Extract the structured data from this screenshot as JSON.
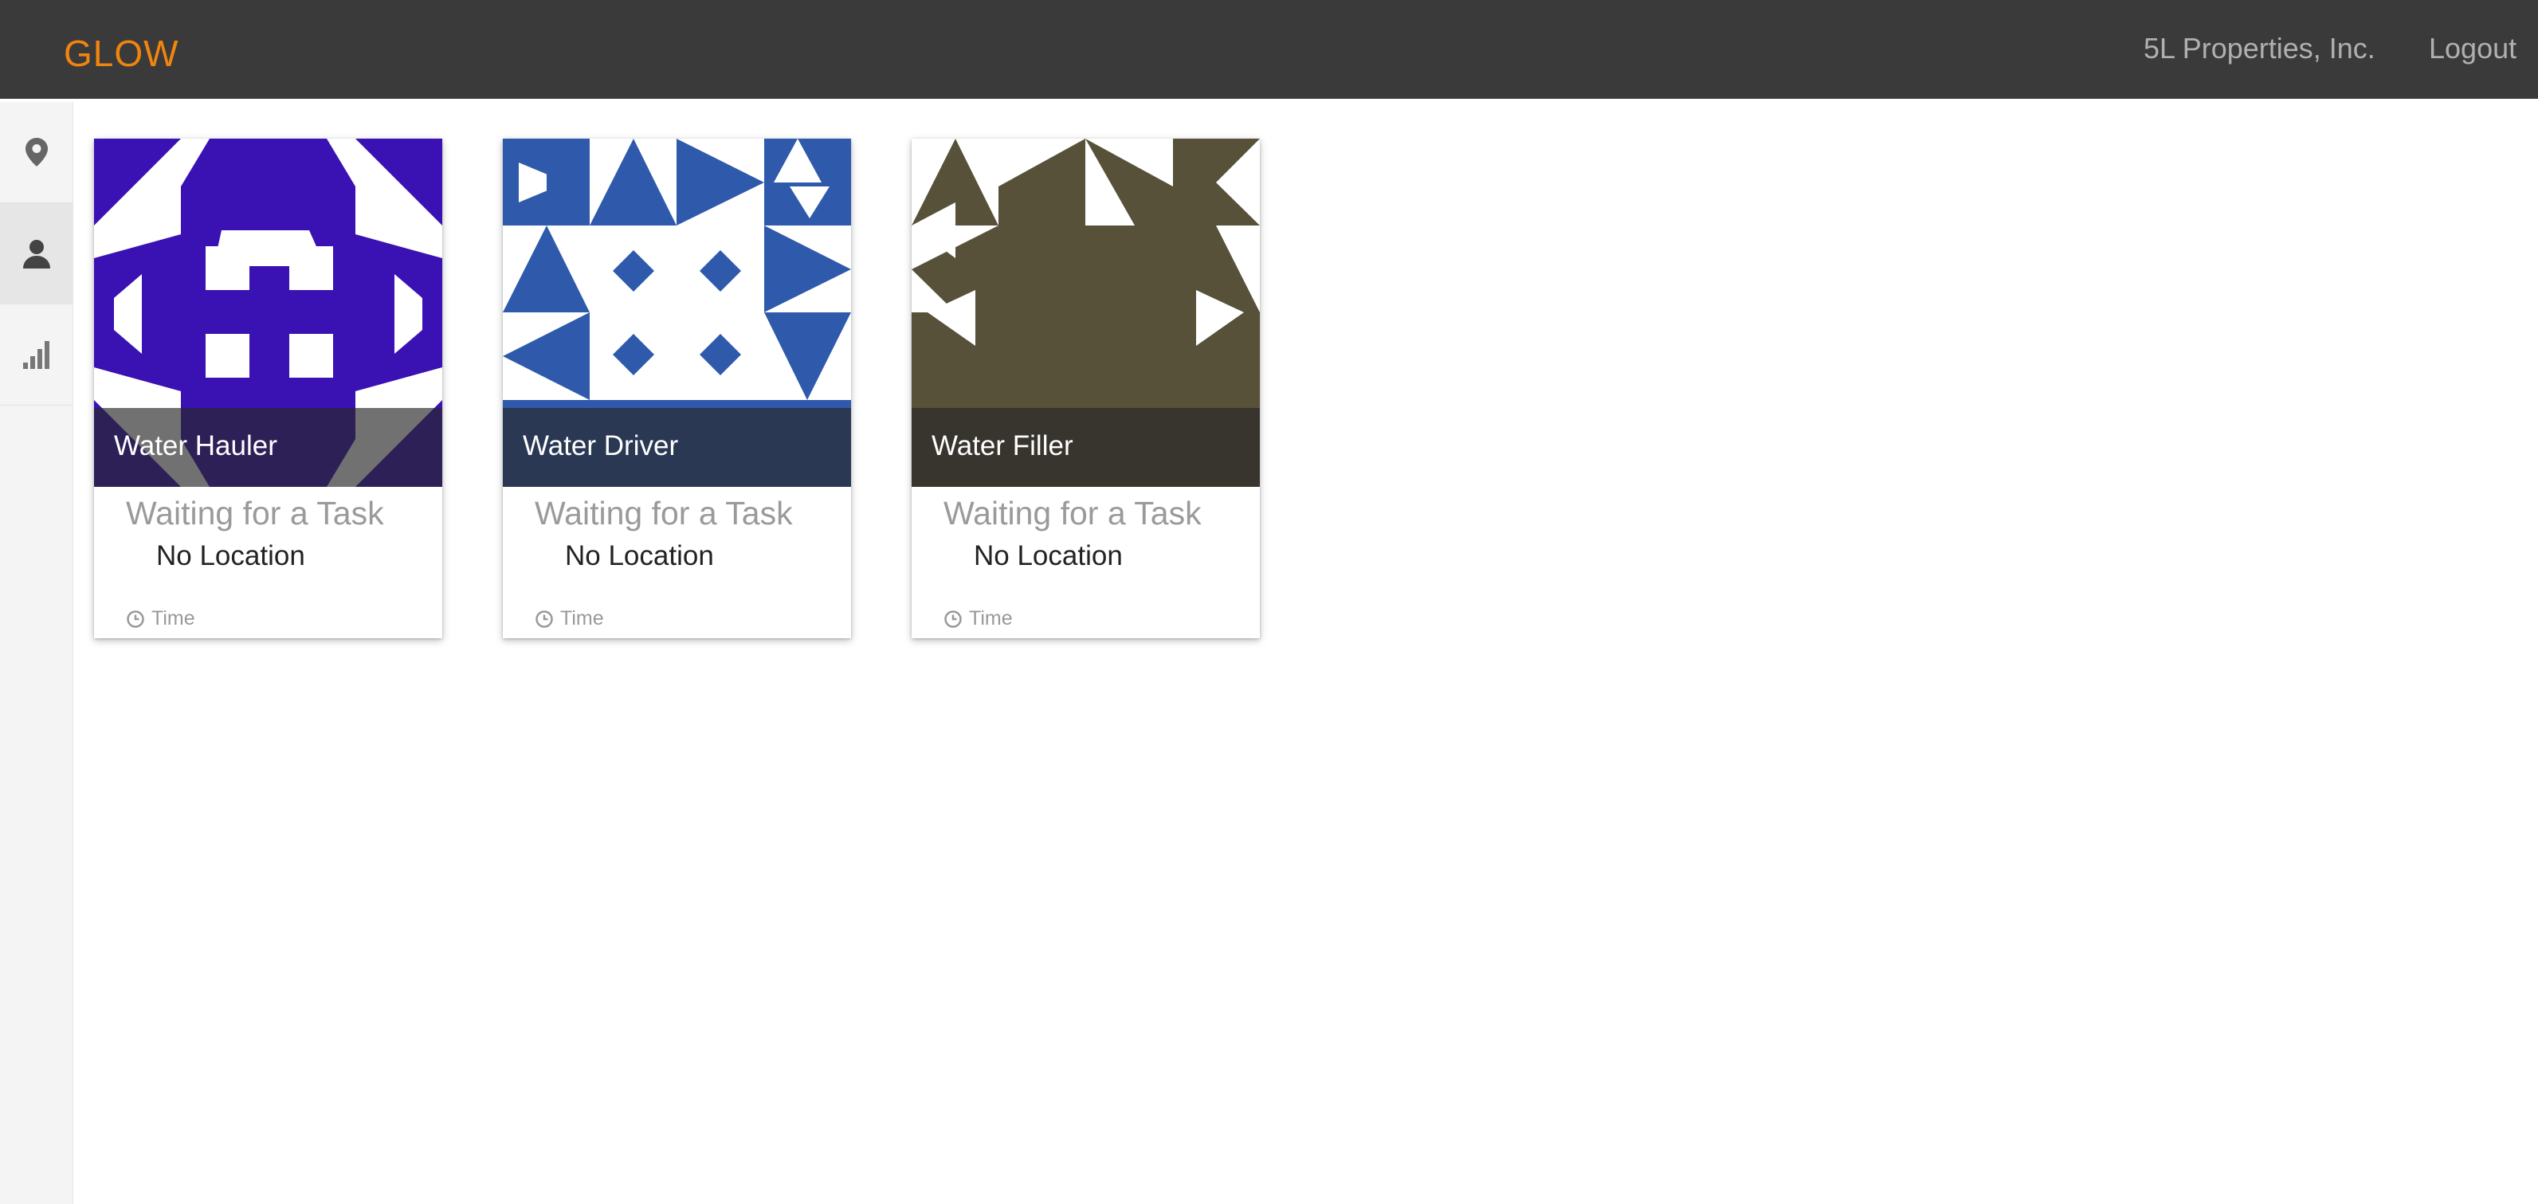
{
  "header": {
    "brand": "GLOW",
    "company": "5L Properties, Inc.",
    "logout_label": "Logout"
  },
  "sidebar": {
    "items": [
      {
        "icon": "map-pin-icon",
        "active": false
      },
      {
        "icon": "user-icon",
        "active": true
      },
      {
        "icon": "signal-bars-icon",
        "active": false
      }
    ]
  },
  "cards": [
    {
      "name": "Water Hauler",
      "status": "Waiting for a Task",
      "location": "No Location",
      "time_label": "Time",
      "avatar_color": "#3a12b3"
    },
    {
      "name": "Water Driver",
      "status": "Waiting for a Task",
      "location": "No Location",
      "time_label": "Time",
      "avatar_color": "#2f5aab"
    },
    {
      "name": "Water Filler",
      "status": "Waiting for a Task",
      "location": "No Location",
      "time_label": "Time",
      "avatar_color": "#57513a"
    }
  ],
  "colors": {
    "topbar": "#3a3a3a",
    "brand": "#f0850e",
    "header_text": "#b0b0b0",
    "sidebar": "#f4f4f4"
  }
}
